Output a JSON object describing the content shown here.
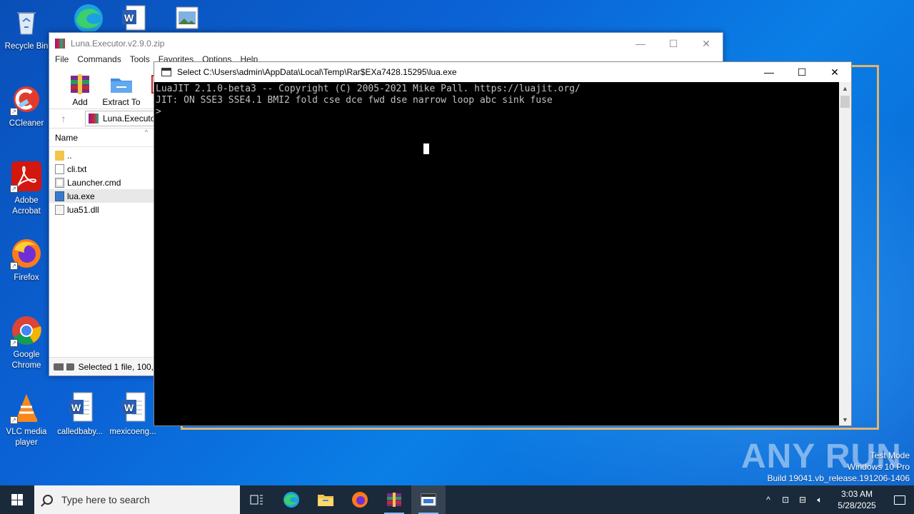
{
  "desktop": {
    "icons": [
      {
        "label": "Recycle Bin",
        "icon": "recycle-bin-icon"
      },
      {
        "label": "CCleaner",
        "icon": "ccleaner-icon"
      },
      {
        "label": "Adobe Acrobat",
        "icon": "adobe-acrobat-icon"
      },
      {
        "label": "Firefox",
        "icon": "firefox-icon"
      },
      {
        "label": "Google Chrome",
        "icon": "chrome-icon"
      },
      {
        "label": "VLC media player",
        "icon": "vlc-icon"
      },
      {
        "label": "calledbaby...",
        "icon": "word-document-icon"
      },
      {
        "label": "mexicoeng...",
        "icon": "word-document-icon"
      }
    ]
  },
  "winrar": {
    "title": "Luna.Executor.v2.9.0.zip",
    "menu": [
      "File",
      "Commands",
      "Tools",
      "Favorites",
      "Options",
      "Help"
    ],
    "toolbar": [
      {
        "label": "Add",
        "icon": "add-archive-icon"
      },
      {
        "label": "Extract To",
        "icon": "extract-to-icon"
      }
    ],
    "address": "Luna.Executor.v2.9.0.zip",
    "column_name": "Name",
    "files": [
      {
        "name": "..",
        "type": "folder"
      },
      {
        "name": "cli.txt",
        "type": "txt"
      },
      {
        "name": "Launcher.cmd",
        "type": "cmd"
      },
      {
        "name": "lua.exe",
        "type": "exe",
        "selected": true
      },
      {
        "name": "lua51.dll",
        "type": "dll"
      }
    ],
    "status": "Selected 1 file, 100,"
  },
  "console": {
    "title": "Select C:\\Users\\admin\\AppData\\Local\\Temp\\Rar$EXa7428.15295\\lua.exe",
    "lines": [
      "LuaJIT 2.1.0-beta3 -- Copyright (C) 2005-2021 Mike Pall. https://luajit.org/",
      "JIT: ON SSE3 SSE4.1 BMI2 fold cse dce fwd dse narrow loop abc sink fuse",
      ">"
    ]
  },
  "watermark": {
    "brand": "ANY RUN",
    "mode": "Test Mode",
    "edition": "Windows 10 Pro",
    "build": "Build 19041.vb_release.191206-1406"
  },
  "taskbar": {
    "search_placeholder": "Type here to search",
    "time": "3:03 AM",
    "date": "5/28/2025"
  }
}
